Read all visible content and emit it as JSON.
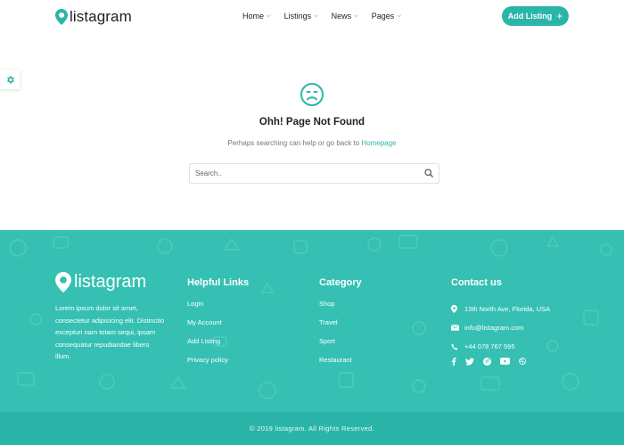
{
  "brand": {
    "name": "listagram",
    "accent": "#2bb5a8",
    "footer_bg": "#35c0b3"
  },
  "nav": {
    "items": [
      {
        "label": "Home"
      },
      {
        "label": "Listings"
      },
      {
        "label": "News"
      },
      {
        "label": "Pages"
      }
    ],
    "cta_label": "Add Listing"
  },
  "error": {
    "title": "Ohh! Page Not Found",
    "subtitle_prefix": "Perhaps searching can help or go back to ",
    "subtitle_link": "Homepage",
    "search_placeholder": "Search.."
  },
  "footer": {
    "brand": "listagram",
    "description": "Lorem ipsum dolor sit amet, consectetur adipisicing elit. Distinctio excepturi nam totam sequi, ipsam consequatur repudiandae libero illum.",
    "helpful": {
      "title": "Helpful Links",
      "links": [
        "Login",
        "My Account",
        "Add Listing",
        "Privacy policy"
      ]
    },
    "category": {
      "title": "Category",
      "links": [
        "Shop",
        "Travel",
        "Sport",
        "Restaurant"
      ]
    },
    "contact": {
      "title": "Contact us",
      "address": "13th North Ave, Florida, USA",
      "email": "info@listagram.com",
      "phone": "+44 078 767 595",
      "social": [
        "facebook-icon",
        "twitter-icon",
        "pinterest-icon",
        "youtube-icon",
        "dribbble-icon"
      ]
    },
    "copyright": "© 2019 listagram. All Rights Reserved."
  }
}
